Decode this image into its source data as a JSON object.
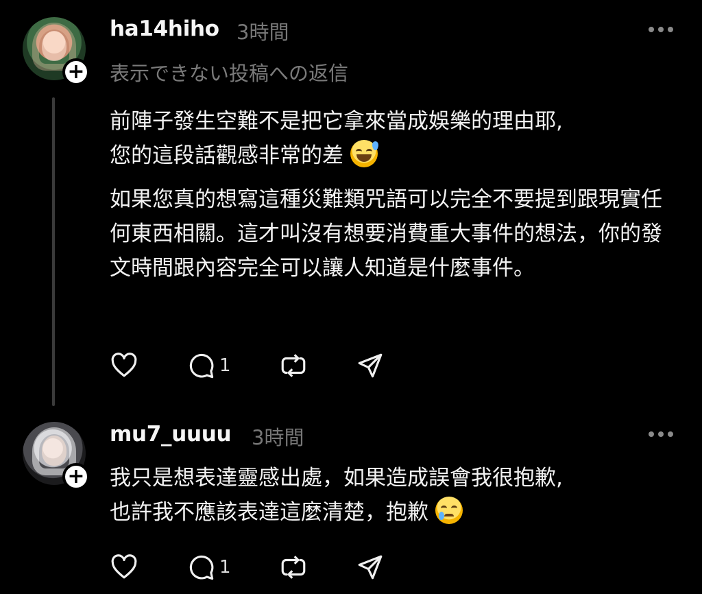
{
  "posts": [
    {
      "username": "ha14hiho",
      "time": "3時間",
      "reply_to": "表示できない投稿への返信",
      "paragraphs": [
        "前陣子發生空難不是把它拿來當成娛樂的理由耶,",
        "您的這段話觀感非常的差",
        "如果您真的想寫這種災難類咒語可以完全不要提到跟現實任何東西相關。這才叫沒有想要消費重大事件的想法，你的發文時間跟內容完全可以讓人知道是什麼事件。"
      ],
      "emoji": "sweat-smile-emoji",
      "reply_count": "1"
    },
    {
      "username": "mu7_uuuu",
      "time": "3時間",
      "paragraphs": [
        "我只是想表達靈感出處，如果造成誤會我很抱歉,",
        "也許我不應該表達這麼清楚，抱歉"
      ],
      "emoji": "crying-face-emoji",
      "reply_count": "1"
    }
  ],
  "colors": {
    "background": "#000000",
    "text": "#f2f2f2",
    "muted": "#777777"
  }
}
